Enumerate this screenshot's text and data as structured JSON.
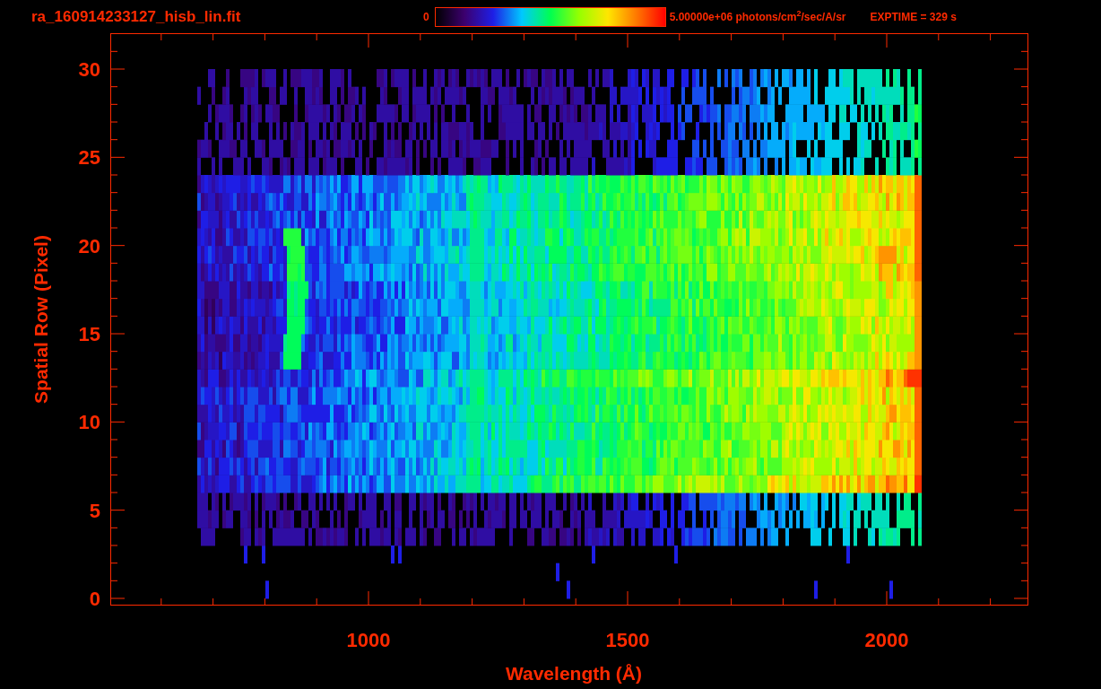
{
  "title": "ra_160914233127_hisb_lin.fit",
  "colorbar": {
    "min_label": "0",
    "max_label": "5.00000e+06 photons/cm$^{2}$/sec/A/sr"
  },
  "exposure": "EXPTIME = 329 s",
  "y_axis": {
    "label": "Spatial Row (Pixel)",
    "ticks": [
      "30",
      "25",
      "20",
      "15",
      "10",
      "5",
      "0"
    ]
  },
  "x_axis": {
    "label": "Wavelength (Å)",
    "ticks": [
      "1000",
      "1500",
      "2000"
    ]
  }
}
